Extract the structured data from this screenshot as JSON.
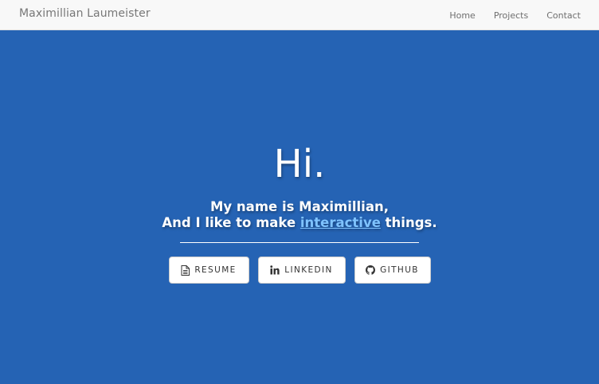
{
  "navbar": {
    "brand": "Maximillian Laumeister",
    "links": [
      "Home",
      "Projects",
      "Contact"
    ]
  },
  "hero": {
    "greeting": "Hi.",
    "line1": "My name is Maximillian,",
    "line2_prefix": "And I like to make ",
    "line2_link": "interactive",
    "line2_suffix": " things."
  },
  "buttons": {
    "resume": {
      "label": "RESUME",
      "icon": "document-icon"
    },
    "linkedin": {
      "label": "LINKEDIN",
      "icon": "linkedin-icon"
    },
    "github": {
      "label": "GITHUB",
      "icon": "github-icon"
    }
  },
  "colors": {
    "hero_bg": "#2563b4",
    "link": "#7fc3ff",
    "navbar_bg": "#f8f8f8"
  }
}
